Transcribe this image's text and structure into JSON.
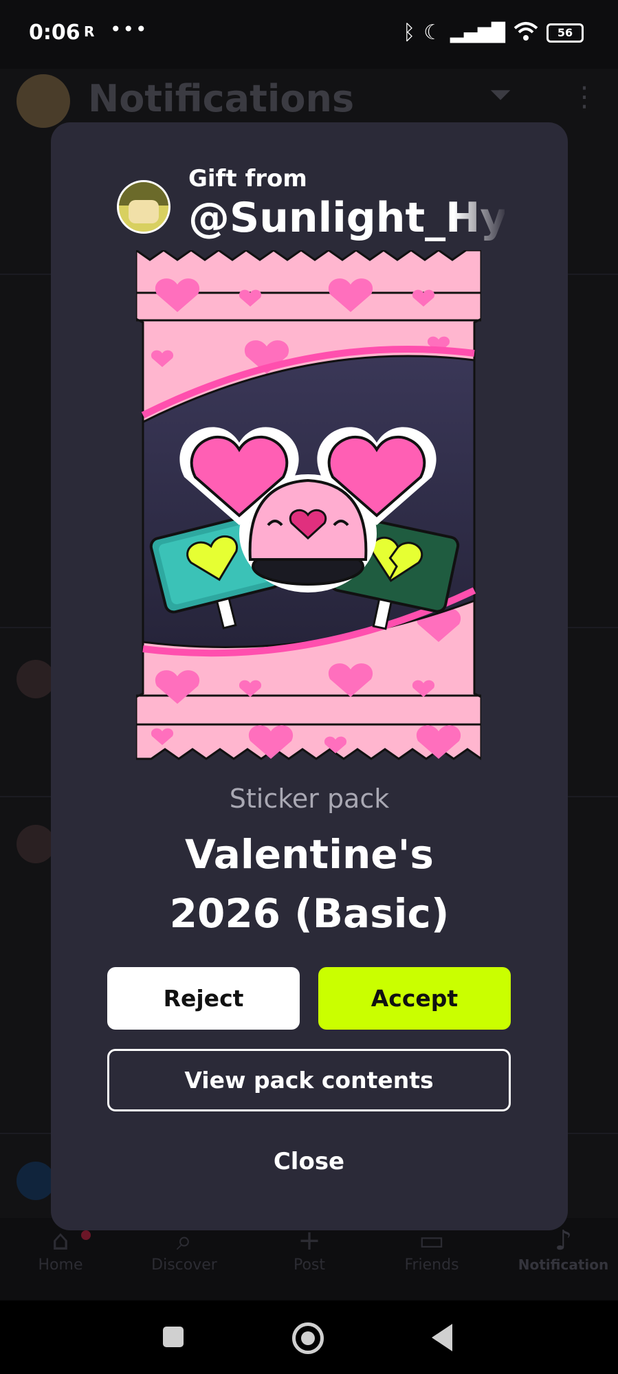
{
  "status_bar": {
    "time": "0:06",
    "sim_label": "R",
    "more_dots": "•••",
    "battery": "56"
  },
  "background": {
    "title": "Notifications",
    "nav": [
      {
        "label": "Home",
        "icon": "home-icon"
      },
      {
        "label": "Discover",
        "icon": "search-icon"
      },
      {
        "label": "Post",
        "icon": "plus-icon"
      },
      {
        "label": "Friends",
        "icon": "chat-icon"
      },
      {
        "label": "Notification",
        "icon": "bell-icon"
      }
    ]
  },
  "gift": {
    "from_label": "Gift from",
    "username": "@Sunlight_Hybri",
    "pack_type": "Sticker pack",
    "pack_name": "Valentine's 2026 (Basic)"
  },
  "actions": {
    "reject": "Reject",
    "accept": "Accept",
    "view_contents": "View pack contents",
    "close": "Close"
  },
  "colors": {
    "accent": "#caff00",
    "modal_bg": "#2b2a38",
    "pack_pink": "#ffb6cf",
    "heart_pink": "#ff5fb4"
  }
}
